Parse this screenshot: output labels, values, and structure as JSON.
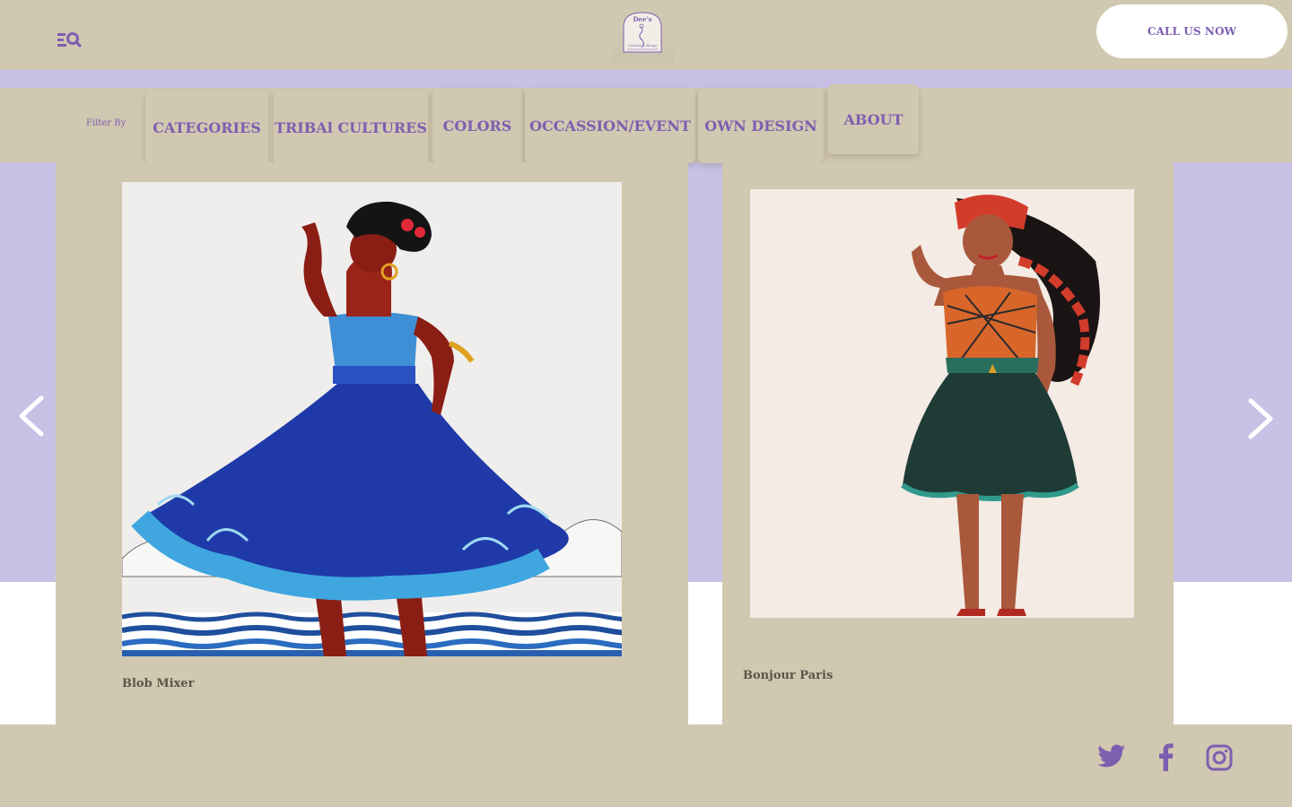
{
  "header": {
    "call_label": "CALL US NOW",
    "logo_text_top": "Dee's",
    "logo_text_bottom": "Couture in Kenya"
  },
  "filter": {
    "label": "Filter By",
    "items": [
      {
        "label": "CATEGORIES"
      },
      {
        "label": "TRIBAl CULTURES"
      },
      {
        "label": "COLORS"
      },
      {
        "label": "OCCASSION/EVENT"
      },
      {
        "label": "OWN DESIGN"
      },
      {
        "label": "ABOUT"
      }
    ]
  },
  "carousel": {
    "cards": [
      {
        "title": "Blob Mixer"
      },
      {
        "title": "Bonjour Paris"
      }
    ]
  },
  "icons": {
    "menu_search": "menu-search-icon",
    "prev": "chevron-left-icon",
    "next": "chevron-right-icon",
    "social": [
      "twitter-icon",
      "facebook-icon",
      "instagram-icon"
    ]
  },
  "colors": {
    "accent": "#7d5fb0",
    "beige": "#d1c8b1",
    "lavender": "#c9c0e6",
    "white": "#ffffff"
  }
}
